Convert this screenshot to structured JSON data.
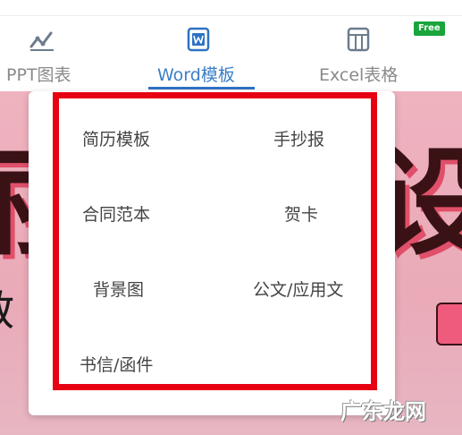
{
  "tabs": [
    {
      "label": "PPT图表",
      "icon": "line-chart-icon",
      "active": false
    },
    {
      "label": "Word模板",
      "icon": "word-doc-icon",
      "active": true
    },
    {
      "label": "Excel表格",
      "icon": "spreadsheet-icon",
      "active": false,
      "badge": "Free"
    }
  ],
  "dropdown": {
    "items": [
      "简历模板",
      "手抄报",
      "合同范本",
      "贺卡",
      "背景图",
      "公文/应用文",
      "书信/函件"
    ]
  },
  "watermark": "广东龙网",
  "colors": {
    "accent": "#2f72c4",
    "highlight_frame": "#e60012",
    "free_badge": "#19a53c",
    "banner": "#eaaab8"
  }
}
